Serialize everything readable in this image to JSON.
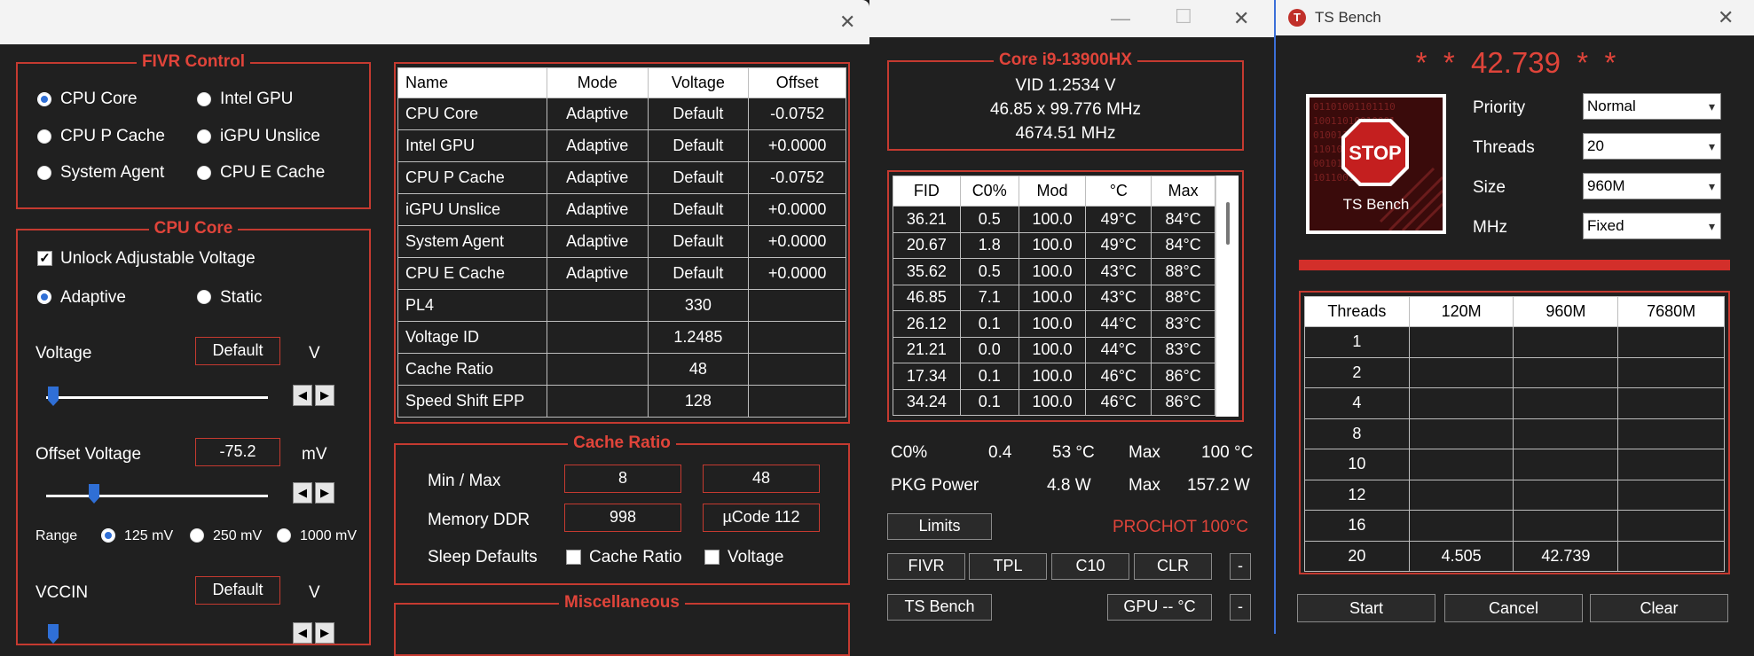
{
  "main_window": {
    "close_glyph": "✕",
    "fivr_control": {
      "title": "FIVR Control",
      "radios": [
        {
          "label": "CPU Core",
          "selected": true
        },
        {
          "label": "Intel GPU",
          "selected": false
        },
        {
          "label": "CPU P Cache",
          "selected": false
        },
        {
          "label": "iGPU Unslice",
          "selected": false
        },
        {
          "label": "System Agent",
          "selected": false
        },
        {
          "label": "CPU E Cache",
          "selected": false
        }
      ]
    },
    "cpu_core": {
      "title": "CPU Core",
      "unlock_label": "Unlock Adjustable Voltage",
      "unlock_checked": true,
      "adaptive_label": "Adaptive",
      "static_label": "Static",
      "voltage_label": "Voltage",
      "voltage_value": "Default",
      "voltage_unit": "V",
      "offset_label": "Offset Voltage",
      "offset_value": "-75.2",
      "offset_unit": "mV",
      "range_label": "Range",
      "range_options": [
        "125 mV",
        "250 mV",
        "1000 mV"
      ],
      "vccin_label": "VCCIN",
      "vccin_value": "Default",
      "vccin_unit": "V",
      "spin_left": "◀",
      "spin_right": "▶"
    },
    "voltage_table": {
      "headers": [
        "Name",
        "Mode",
        "Voltage",
        "Offset"
      ],
      "rows": [
        [
          "CPU Core",
          "Adaptive",
          "Default",
          "-0.0752"
        ],
        [
          "Intel GPU",
          "Adaptive",
          "Default",
          "+0.0000"
        ],
        [
          "CPU P Cache",
          "Adaptive",
          "Default",
          "-0.0752"
        ],
        [
          "iGPU Unslice",
          "Adaptive",
          "Default",
          "+0.0000"
        ],
        [
          "System Agent",
          "Adaptive",
          "Default",
          "+0.0000"
        ],
        [
          "CPU E Cache",
          "Adaptive",
          "Default",
          "+0.0000"
        ],
        [
          "PL4",
          "",
          "330",
          ""
        ],
        [
          "Voltage ID",
          "",
          "1.2485",
          ""
        ],
        [
          "Cache Ratio",
          "",
          "48",
          ""
        ],
        [
          "Speed Shift EPP",
          "",
          "128",
          ""
        ]
      ]
    },
    "cache_ratio": {
      "title": "Cache Ratio",
      "minmax_label": "Min / Max",
      "min_value": "8",
      "max_value": "48",
      "memory_label": "Memory DDR",
      "memory_value": "998",
      "ucode_value": "µCode 112",
      "sleep_label": "Sleep Defaults",
      "sleep_cache_label": "Cache Ratio",
      "sleep_voltage_label": "Voltage"
    },
    "misc": {
      "title": "Miscellaneous"
    }
  },
  "monitor_window": {
    "minimize_glyph": "—",
    "maximize_glyph": "☐",
    "close_glyph": "✕",
    "cpu_title": "Core i9-13900HX",
    "vid_line": "VID  1.2534 V",
    "freq_line1": "46.85 x 99.776 MHz",
    "freq_line2": "4674.51 MHz",
    "core_table": {
      "headers": [
        "FID",
        "C0%",
        "Mod",
        "°C",
        "Max"
      ],
      "rows": [
        [
          "36.21",
          "0.5",
          "100.0",
          "49°C",
          "84°C"
        ],
        [
          "20.67",
          "1.8",
          "100.0",
          "49°C",
          "84°C"
        ],
        [
          "35.62",
          "0.5",
          "100.0",
          "43°C",
          "88°C"
        ],
        [
          "46.85",
          "7.1",
          "100.0",
          "43°C",
          "88°C"
        ],
        [
          "26.12",
          "0.1",
          "100.0",
          "44°C",
          "83°C"
        ],
        [
          "21.21",
          "0.0",
          "100.0",
          "44°C",
          "83°C"
        ],
        [
          "17.34",
          "0.1",
          "100.0",
          "46°C",
          "86°C"
        ],
        [
          "34.24",
          "0.1",
          "100.0",
          "46°C",
          "86°C"
        ]
      ]
    },
    "stats": {
      "c0_label": "C0%",
      "c0_value": "0.4",
      "temp_value": "53 °C",
      "max_label": "Max",
      "temp_max": "100 °C",
      "pkg_label": "PKG Power",
      "pkg_value": "4.8 W",
      "pkg_max": "157.2 W"
    },
    "limits_button": "Limits",
    "prochot_text": "PROCHOT 100°C",
    "buttons_row1": [
      "FIVR",
      "TPL",
      "C10",
      "CLR"
    ],
    "dash_button": "-",
    "ts_bench_button": "TS Bench",
    "gpu_button": "GPU -- °C"
  },
  "bench_window": {
    "title": "TS Bench",
    "app_icon_letter": "T",
    "close_glyph": "✕",
    "score_display": "*  *  42.739  *  *",
    "logo_stop": "STOP",
    "logo_caption": "TS Bench",
    "priority_label": "Priority",
    "priority_value": "Normal",
    "threads_label": "Threads",
    "threads_value": "20",
    "size_label": "Size",
    "size_value": "960M",
    "mhz_label": "MHz",
    "mhz_value": "Fixed",
    "progress": 1.0,
    "results_table": {
      "headers": [
        "Threads",
        "120M",
        "960M",
        "7680M"
      ],
      "rows": [
        [
          "1",
          "",
          "",
          ""
        ],
        [
          "2",
          "",
          "",
          ""
        ],
        [
          "4",
          "",
          "",
          ""
        ],
        [
          "8",
          "",
          "",
          ""
        ],
        [
          "10",
          "",
          "",
          ""
        ],
        [
          "12",
          "",
          "",
          ""
        ],
        [
          "16",
          "",
          "",
          ""
        ],
        [
          "20",
          "4.505",
          "42.739",
          ""
        ]
      ]
    },
    "start_button": "Start",
    "cancel_button": "Cancel",
    "clear_button": "Clear"
  },
  "colors": {
    "accent_red": "#e0443a",
    "border_red": "#c53a30",
    "radio_blue": "#2f6fd6",
    "background": "#202020"
  }
}
